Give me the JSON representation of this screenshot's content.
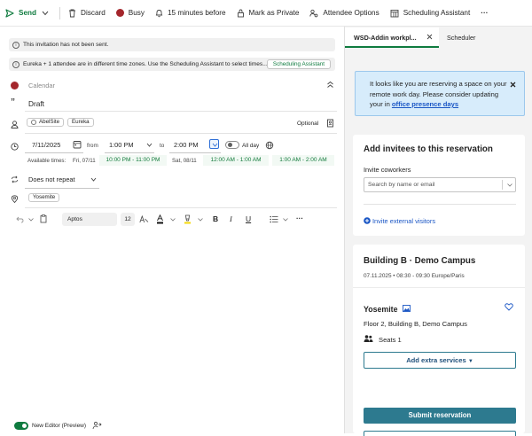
{
  "toolbar": {
    "send": "Send",
    "discard": "Discard",
    "busy": "Busy",
    "reminder": "15 minutes before",
    "private": "Mark as Private",
    "attendee_options": "Attendee Options",
    "scheduling": "Scheduling Assistant",
    "more": "···"
  },
  "notices": {
    "not_sent": "This invitation has not been sent.",
    "timezones": "Eureka + 1 attendee are in different time zones. Use the Scheduling Assistant to select times...",
    "scheduling_btn": "Scheduling Assistant"
  },
  "compose": {
    "calendar": "Calendar",
    "title": "Draft",
    "attendees": [
      "AbelSite",
      "Eureka"
    ],
    "optional": "Optional",
    "start_date": "7/11/2025",
    "from_label": "from",
    "start_time": "1:00 PM",
    "to_label": "to",
    "end_time": "2:00 PM",
    "all_day": "All day",
    "available_label": "Available times:",
    "day1": "Fri, 07/11",
    "slot1": "10:00 PM - 11:00 PM",
    "day2": "Sat, 08/11",
    "slot2": "12:00 AM - 1:00 AM",
    "slot3": "1:00 AM - 2:00 AM",
    "repeat": "Does not repeat",
    "location": "Yosemite",
    "font": "Aptos",
    "font_size": "12",
    "bold": "B",
    "italic": "I",
    "underline": "U",
    "more": "···",
    "new_editor": "New Editor (Preview)"
  },
  "pane": {
    "tab_addin": "WSD-Addin workpl...",
    "tab_scheduler": "Scheduler",
    "banner_text": "It looks like you are reserving a space on your remote work day. Please consider updating your in",
    "banner_link": "office presence days",
    "invite_title": "Add invitees to this reservation",
    "invite_label": "Invite coworkers",
    "invite_placeholder": "Search by name or email",
    "external": "Invite external visitors",
    "building": "Building B · Demo Campus",
    "datetime": "07.11.2025 • 08:30 - 09:30 Europe/Paris",
    "room": "Yosemite",
    "room_location": "Floor 2, Building B, Demo Campus",
    "seats": "Seats 1",
    "extra_services": "Add extra services",
    "submit": "Submit reservation"
  },
  "colors": {
    "brand_green": "#0f7b3f",
    "teal_button": "#2d7a8f",
    "busy_red": "#a4262c",
    "banner_bg": "#d7ecfb"
  }
}
